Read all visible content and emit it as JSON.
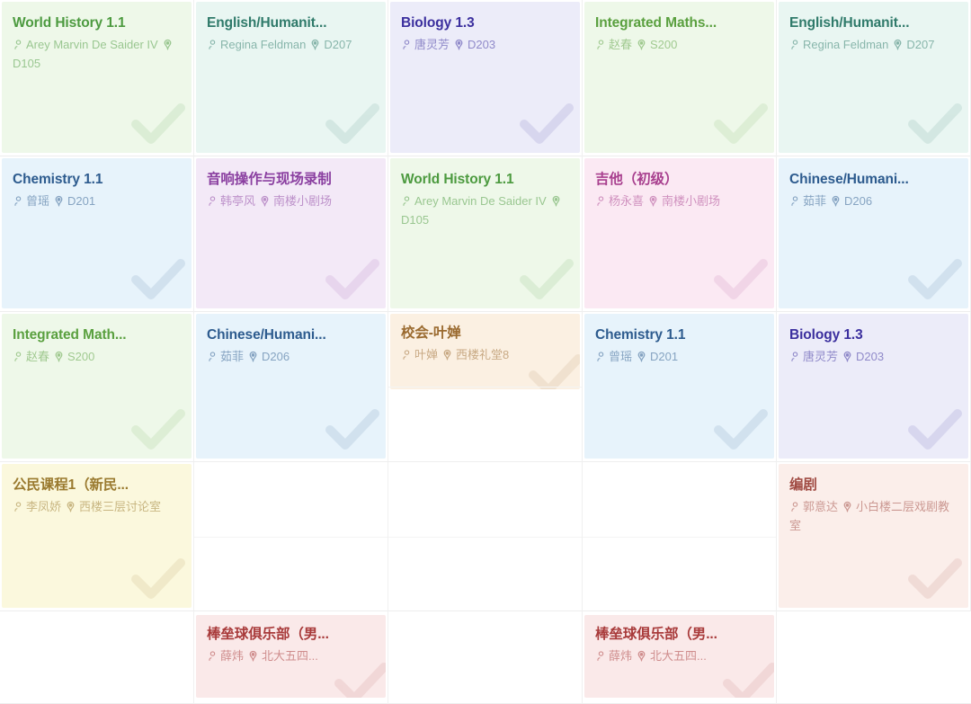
{
  "view": {
    "type": "weekly-timetable",
    "columns": 5,
    "rows": 5
  },
  "icons": {
    "person": "person-icon",
    "location": "location-pin-icon",
    "check": "check-icon"
  },
  "palette": {
    "green": {
      "bg": "#eef8e9",
      "title": "#4c9a3f",
      "text": "#4c9a3f"
    },
    "green_light": {
      "bg": "#eef8e9",
      "title": "#5aa03f",
      "text": "#5aa03f"
    },
    "teal": {
      "bg": "#e9f6f2",
      "title": "#2f7a6a",
      "text": "#2f7a6a"
    },
    "indigo": {
      "bg": "#ececf9",
      "title": "#3b2f9e",
      "text": "#3b2f9e"
    },
    "blue": {
      "bg": "#e7f3fb",
      "title": "#2d5b8e",
      "text": "#2d5b8e"
    },
    "purple": {
      "bg": "#f3e9f7",
      "title": "#8a3fa0",
      "text": "#8a3fa0"
    },
    "pink": {
      "bg": "#fbe9f3",
      "title": "#a83f8e",
      "text": "#a83f8e"
    },
    "orange": {
      "bg": "#fbf0e2",
      "title": "#9a6a2f",
      "text": "#9a6a2f"
    },
    "yellow": {
      "bg": "#fbf8dd",
      "title": "#9a7a2f",
      "text": "#9a7a2f"
    },
    "rose": {
      "bg": "#fbeeea",
      "title": "#a04a42",
      "text": "#a04a42"
    },
    "red": {
      "bg": "#fae9e9",
      "title": "#a83a3a",
      "text": "#a83a3a"
    }
  },
  "cells": [
    {
      "r": 1,
      "c": 1,
      "card": {
        "title": "World History 1.1",
        "teacher": "Arey Marvin De Saider IV",
        "room": "D105",
        "color": "green",
        "checked": true,
        "size": "full"
      }
    },
    {
      "r": 1,
      "c": 2,
      "card": {
        "title": "English/Humanit...",
        "teacher": "Regina Feldman",
        "room": "D207",
        "color": "teal",
        "checked": true,
        "size": "full"
      }
    },
    {
      "r": 1,
      "c": 3,
      "card": {
        "title": "Biology 1.3",
        "teacher": "唐灵芳",
        "room": "D203",
        "color": "indigo",
        "checked": true,
        "size": "full"
      }
    },
    {
      "r": 1,
      "c": 4,
      "card": {
        "title": "Integrated Maths...",
        "teacher": "赵春",
        "room": "S200",
        "color": "green_light",
        "checked": true,
        "size": "full"
      }
    },
    {
      "r": 1,
      "c": 5,
      "card": {
        "title": "English/Humanit...",
        "teacher": "Regina Feldman",
        "room": "D207",
        "color": "teal",
        "checked": true,
        "size": "full"
      }
    },
    {
      "r": 2,
      "c": 1,
      "card": {
        "title": "Chemistry 1.1",
        "teacher": "曾瑶",
        "room": "D201",
        "color": "blue",
        "checked": true,
        "size": "full"
      }
    },
    {
      "r": 2,
      "c": 2,
      "card": {
        "title": "音响操作与现场录制",
        "teacher": "韩亭风",
        "room": "南楼小剧场",
        "color": "purple",
        "checked": true,
        "size": "full"
      }
    },
    {
      "r": 2,
      "c": 3,
      "card": {
        "title": "World History 1.1",
        "teacher": "Arey Marvin De Saider IV",
        "room": "D105",
        "color": "green",
        "checked": true,
        "size": "full"
      }
    },
    {
      "r": 2,
      "c": 4,
      "card": {
        "title": "吉他（初级）",
        "teacher": "杨永喜",
        "room": "南楼小剧场",
        "color": "pink",
        "checked": true,
        "size": "full"
      }
    },
    {
      "r": 2,
      "c": 5,
      "card": {
        "title": "Chinese/Humani...",
        "teacher": "茹菲",
        "room": "D206",
        "color": "blue",
        "checked": true,
        "size": "full"
      }
    },
    {
      "r": 3,
      "c": 1,
      "card": {
        "title": "Integrated Math...",
        "teacher": "赵春",
        "room": "S200",
        "color": "green_light",
        "checked": true,
        "size": "full"
      }
    },
    {
      "r": 3,
      "c": 2,
      "card": {
        "title": "Chinese/Humani...",
        "teacher": "茹菲",
        "room": "D206",
        "color": "blue",
        "checked": true,
        "size": "full"
      }
    },
    {
      "r": 3,
      "c": 3,
      "card": {
        "title": "校会-叶婵",
        "teacher": "叶婵",
        "room": "西楼礼堂8",
        "color": "orange",
        "checked": true,
        "size": "half"
      }
    },
    {
      "r": 3,
      "c": 4,
      "card": {
        "title": "Chemistry 1.1",
        "teacher": "曾瑶",
        "room": "D201",
        "color": "blue",
        "checked": true,
        "size": "full"
      }
    },
    {
      "r": 3,
      "c": 5,
      "card": {
        "title": "Biology 1.3",
        "teacher": "唐灵芳",
        "room": "D203",
        "color": "indigo",
        "checked": true,
        "size": "full"
      }
    },
    {
      "r": 4,
      "c": 1,
      "card": {
        "title": "公民课程1（新民...",
        "teacher": "李凤娇",
        "room": "西楼三层讨论室",
        "color": "yellow",
        "checked": true,
        "size": "full"
      }
    },
    {
      "r": 4,
      "c": 2,
      "card": null
    },
    {
      "r": 4,
      "c": 3,
      "card": null
    },
    {
      "r": 4,
      "c": 4,
      "card": null
    },
    {
      "r": 4,
      "c": 5,
      "card": {
        "title": "编剧",
        "teacher": "郭意达",
        "room": "小白楼二层戏剧教室",
        "color": "rose",
        "checked": true,
        "size": "full"
      }
    },
    {
      "r": 5,
      "c": 1,
      "card": null
    },
    {
      "r": 5,
      "c": 2,
      "card": {
        "title": "棒垒球俱乐部（男...",
        "teacher": "薛炜",
        "room": "北大五四...",
        "color": "red",
        "checked": true,
        "size": "row5"
      }
    },
    {
      "r": 5,
      "c": 3,
      "card": null
    },
    {
      "r": 5,
      "c": 4,
      "card": {
        "title": "棒垒球俱乐部（男...",
        "teacher": "薛炜",
        "room": "北大五四...",
        "color": "red",
        "checked": true,
        "size": "row5"
      }
    },
    {
      "r": 5,
      "c": 5,
      "card": null
    }
  ]
}
